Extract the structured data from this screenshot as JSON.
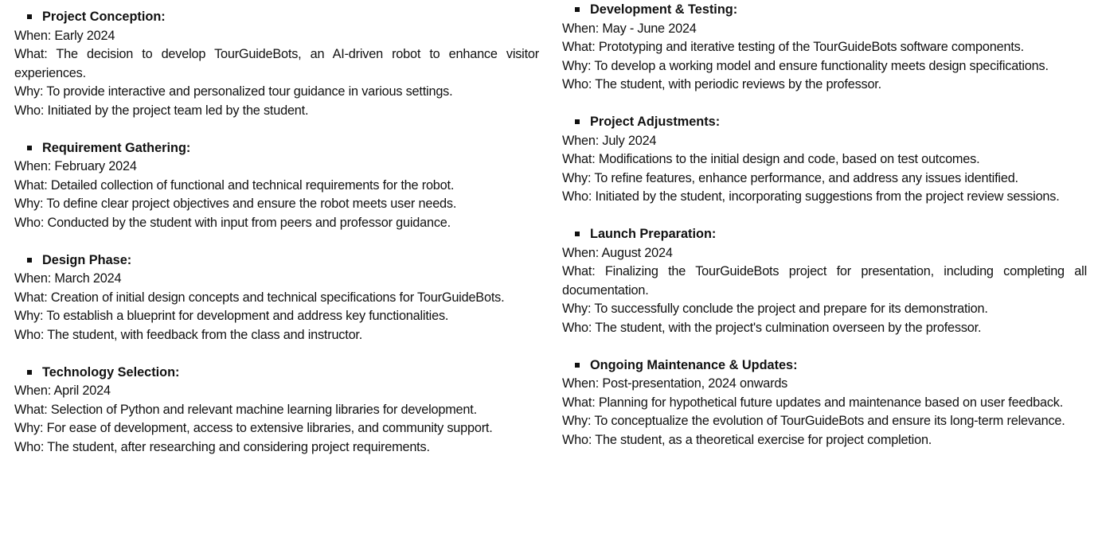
{
  "left": [
    {
      "title": "Project Conception:",
      "when": "When: Early 2024",
      "what": "What: The decision to develop TourGuideBots, an AI-driven robot to enhance visitor experiences.",
      "why": "Why: To provide interactive and personalized tour guidance in various settings.",
      "who": "Who: Initiated by the project team led by the student."
    },
    {
      "title": "Requirement Gathering:",
      "when": "When: February 2024",
      "what": "What: Detailed collection of functional and technical requirements for the robot.",
      "why": "Why: To define clear project objectives and ensure the robot meets user needs.",
      "who": "Who: Conducted by the student with input from peers and professor guidance."
    },
    {
      "title": "Design Phase:",
      "when": "When: March 2024",
      "what": "What: Creation of initial design concepts and technical specifications for TourGuideBots.",
      "why": "Why: To establish a blueprint for development and address key functionalities.",
      "who": "Who: The student, with feedback from the class and instructor."
    },
    {
      "title": "Technology Selection:",
      "when": "When: April 2024",
      "what": "What: Selection of Python and relevant machine learning libraries for development.",
      "why": "Why: For ease of development, access to extensive libraries, and community support.",
      "who": "Who: The student, after researching and considering project requirements."
    }
  ],
  "right": [
    {
      "title": "Development & Testing:",
      "when": "When: May - June 2024",
      "what": "What: Prototyping and iterative testing of the TourGuideBots software components.",
      "why": "Why: To develop a working model and ensure functionality meets design specifications.",
      "who": "Who: The student, with periodic reviews by the professor."
    },
    {
      "title": "Project Adjustments:",
      "when": "When: July 2024",
      "what": "What: Modifications to the initial design and code, based on test outcomes.",
      "why": "Why: To refine features, enhance performance, and address any issues identified.",
      "who": "Who: Initiated by the student, incorporating suggestions from the project review sessions."
    },
    {
      "title": "Launch Preparation:",
      "when": "When: August 2024",
      "what": "What: Finalizing the TourGuideBots project for presentation, including completing all documentation.",
      "why": "Why: To successfully conclude the project and prepare for its demonstration.",
      "who": "Who: The student, with the project's culmination overseen by the professor."
    },
    {
      "title": "Ongoing Maintenance & Updates:",
      "when": "When: Post-presentation, 2024 onwards",
      "what": "What: Planning for hypothetical future updates and maintenance based on user feedback.",
      "why": "Why: To conceptualize the evolution of TourGuideBots and ensure its long-term relevance.",
      "who": "Who: The student, as a theoretical exercise for project completion."
    }
  ]
}
